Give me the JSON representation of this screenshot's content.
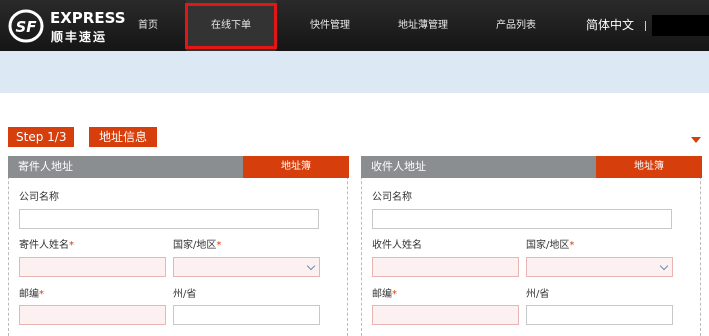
{
  "brand": {
    "logo_text": "SF",
    "express": "EXPRESS",
    "name_cn": "顺丰速运"
  },
  "nav": {
    "home": "首页",
    "order_online": "在线下单",
    "shipment_mgmt": "快件管理",
    "address_book_mgmt": "地址薄管理",
    "product_list": "产品列表",
    "language": "简体中文",
    "separator": "|"
  },
  "step": {
    "badge": "Step 1/3",
    "title": "地址信息"
  },
  "sender": {
    "title": "寄件人地址",
    "address_book_button": "地址簿",
    "company_label": "公司名称",
    "company_value": "",
    "name_label": "寄件人姓名",
    "name_value": "",
    "country_label": "国家/地区",
    "country_value": "",
    "zip_label": "邮编",
    "zip_value": "",
    "state_label": "州/省",
    "state_value": ""
  },
  "recipient": {
    "title": "收件人地址",
    "address_book_button": "地址簿",
    "company_label": "公司名称",
    "company_value": "",
    "name_label": "收件人姓名",
    "name_value": "",
    "country_label": "国家/地区",
    "country_value": "",
    "zip_label": "邮编",
    "zip_value": "",
    "state_label": "州/省",
    "state_value": ""
  },
  "required_mark": "*",
  "colors": {
    "accent": "#d63e0c",
    "nav_bg": "#1e1e1e",
    "banner": "#dce9f4",
    "panel_header": "#8b8e90",
    "required_field": "#fdf0f0",
    "highlight": "#e31616"
  }
}
